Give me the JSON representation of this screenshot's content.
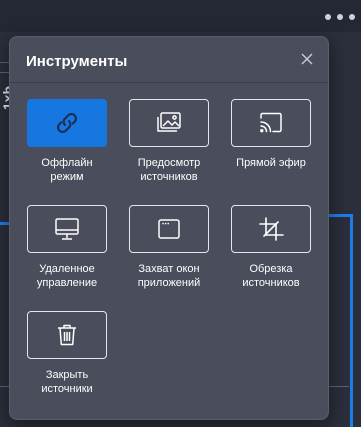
{
  "background": {
    "side_text": "1xb"
  },
  "panel": {
    "title": "Инструменты",
    "close_icon": "close-icon"
  },
  "tools": [
    {
      "name": "offline",
      "icon": "link-icon",
      "label_lines": [
        "Оффлайн",
        "режим"
      ],
      "active": true
    },
    {
      "name": "preview",
      "icon": "image-stack-icon",
      "label_lines": [
        "Предосмотр",
        "источников"
      ],
      "active": false
    },
    {
      "name": "live",
      "icon": "cast-icon",
      "label_lines": [
        "Прямой эфир"
      ],
      "active": false
    },
    {
      "name": "remote",
      "icon": "monitor-icon",
      "label_lines": [
        "Удаленное",
        "управление"
      ],
      "active": false
    },
    {
      "name": "capture",
      "icon": "window-icon",
      "label_lines": [
        "Захват окон",
        "приложений"
      ],
      "active": false
    },
    {
      "name": "crop",
      "icon": "crop-icon",
      "label_lines": [
        "Обрезка",
        "источников"
      ],
      "active": false
    },
    {
      "name": "close-sources",
      "icon": "trash-icon",
      "label_lines": [
        "Закрыть",
        "источники"
      ],
      "active": false
    }
  ],
  "colors": {
    "accent": "#1677e0",
    "panel_bg": "#4a4d5b"
  }
}
